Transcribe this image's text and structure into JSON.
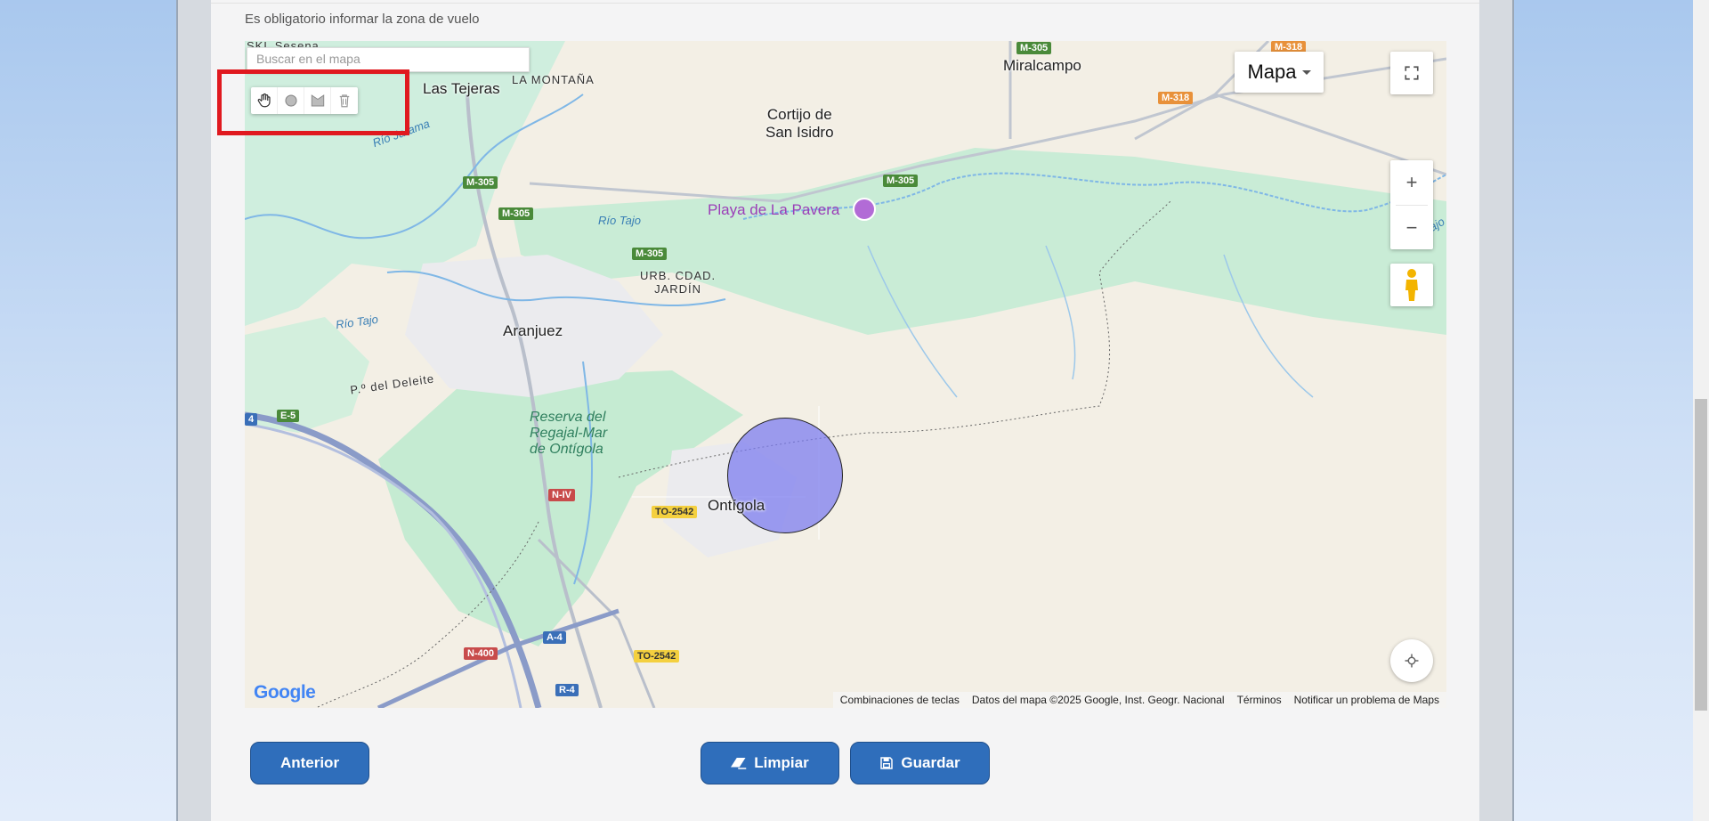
{
  "form": {
    "notice": "Es obligatorio informar la zona de vuelo"
  },
  "map": {
    "search_placeholder": "Buscar en el mapa",
    "map_type_label": "Mapa",
    "places": {
      "las_tejeras": "Las Tejeras",
      "la_montana": "LA MONTAÑA",
      "miralcampo": "Miralcampo",
      "cortijo_1": "Cortijo de",
      "cortijo_2": "San Isidro",
      "playa": "Playa de La Pavera",
      "urb_1": "URB. CDAD.",
      "urb_2": "JARDÍN",
      "aranjuez": "Aranjuez",
      "paseo": "P.º del Deleite",
      "ontigola": "Ontígola",
      "reserva_1": "Reserva del",
      "reserva_2": "Regajal-Mar",
      "reserva_3": "de Ontígola",
      "rio_tajo_1": "Río Tajo",
      "rio_tajo_2": "Río Tajo",
      "rio_tajo_3": "Río Tajo",
      "rio_jarama": "Río Jarama",
      "skl": "SKL Sesena"
    },
    "roads": {
      "m305_a": "M-305",
      "m305_b": "M-305",
      "m305_c": "M-305",
      "m305_d": "M-305",
      "m305_e": "M-305",
      "m318_a": "M-318",
      "m318_b": "M-318",
      "e5": "E-5",
      "niv": "N-IV",
      "to2542_a": "TO-2542",
      "to2542_b": "TO-2542",
      "n400": "N-400",
      "a4": "A-4",
      "r4": "R-4",
      "a4_left": "4"
    },
    "attribution": {
      "shortcuts": "Combinaciones de teclas",
      "data": "Datos del mapa ©2025 Google, Inst. Geogr. Nacional",
      "terms": "Términos",
      "report": "Notificar un problema de Maps"
    },
    "logo": "Google",
    "zoom_in": "+",
    "zoom_out": "−",
    "circle_fill": "#8c8cf2"
  },
  "buttons": {
    "previous": "Anterior",
    "clear": "Limpiar",
    "save": "Guardar"
  },
  "icons": {
    "pan": "hand-icon",
    "circle": "circle-tool-icon",
    "polygon": "polygon-tool-icon",
    "delete": "trash-icon",
    "fullscreen": "fullscreen-icon",
    "pegman": "pegman-icon",
    "locate": "locate-icon",
    "eraser": "eraser-icon",
    "floppy": "save-icon"
  }
}
